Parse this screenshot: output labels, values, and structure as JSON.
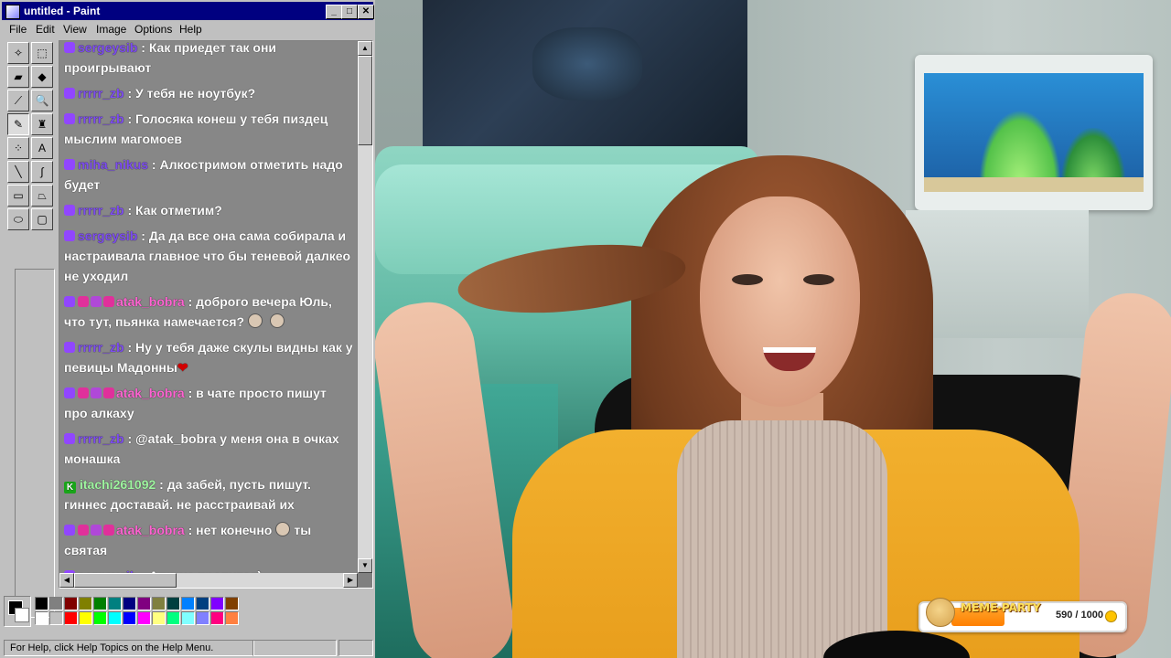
{
  "window": {
    "title": "untitled - Paint",
    "controls": {
      "minimize": "_",
      "maximize": "□",
      "close": "✕"
    }
  },
  "menu": [
    "File",
    "Edit",
    "View",
    "Image",
    "Options",
    "Help"
  ],
  "tools": [
    {
      "name": "free-form-select-icon",
      "glyph": "✧"
    },
    {
      "name": "select-icon",
      "glyph": "⬚"
    },
    {
      "name": "eraser-icon",
      "glyph": "▰"
    },
    {
      "name": "fill-bucket-icon",
      "glyph": "◆"
    },
    {
      "name": "color-picker-icon",
      "glyph": "⟋"
    },
    {
      "name": "magnifier-icon",
      "glyph": "🔍"
    },
    {
      "name": "pencil-icon",
      "glyph": "✎"
    },
    {
      "name": "brush-icon",
      "glyph": "♜"
    },
    {
      "name": "airbrush-icon",
      "glyph": "⁘"
    },
    {
      "name": "text-icon",
      "glyph": "A"
    },
    {
      "name": "line-icon",
      "glyph": "╲"
    },
    {
      "name": "curve-icon",
      "glyph": "∫"
    },
    {
      "name": "rectangle-icon",
      "glyph": "▭"
    },
    {
      "name": "polygon-icon",
      "glyph": "⏢"
    },
    {
      "name": "ellipse-icon",
      "glyph": "⬭"
    },
    {
      "name": "rounded-rectangle-icon",
      "glyph": "▢"
    }
  ],
  "chat": [
    {
      "badges": [
        "sub"
      ],
      "user": "sergeysib",
      "color": "#7d4cf0",
      "text": ": Как приедет так они проигрывают"
    },
    {
      "badges": [
        "sub"
      ],
      "user": "rrrrr_zb",
      "color": "#7d4cf0",
      "text": ": У тебя не ноутбук?"
    },
    {
      "badges": [
        "sub"
      ],
      "user": "rrrrr_zb",
      "color": "#7d4cf0",
      "text": ": Голосяка конеш у тебя пиздец мыслим магомоев"
    },
    {
      "badges": [
        "sub"
      ],
      "user": "miha_nikus",
      "color": "#7d4cf0",
      "text": ": Алкостримом отметить надо будет"
    },
    {
      "badges": [
        "sub"
      ],
      "user": "rrrrr_zb",
      "color": "#7d4cf0",
      "text": ": Как отметим?"
    },
    {
      "badges": [
        "sub"
      ],
      "user": "sergeysib",
      "color": "#7d4cf0",
      "text": ": Да да все она сама собирала и настраивала главное что бы теневой далкео не уходил"
    },
    {
      "badges": [
        "sub",
        "heart",
        "gift",
        "heart"
      ],
      "user": "atak_bobra",
      "color": "#ff64d2",
      "text": ": доброго вечера Юль, что тут, пьянка намечается?",
      "emotes": 2
    },
    {
      "badges": [
        "sub"
      ],
      "user": "rrrrr_zb",
      "color": "#7d4cf0",
      "text": ": Ну у тебя даже скулы видны как у певицы Мадонны",
      "heart": "❤"
    },
    {
      "badges": [
        "sub",
        "heart",
        "gift",
        "heart"
      ],
      "user": "atak_bobra",
      "color": "#ff64d2",
      "text": ": в чате просто пишут про алкаху"
    },
    {
      "badges": [
        "sub"
      ],
      "user": "rrrrr_zb",
      "color": "#7d4cf0",
      "text": ": @atak_bobra у меня она в очках монашка"
    },
    {
      "badges": [
        "k"
      ],
      "user": "itachi261092",
      "color": "#9ff5a0",
      "text": ": да забей, пусть пишут. гиннес доставай. не расстраивай их"
    },
    {
      "badges": [
        "sub",
        "heart",
        "gift",
        "heart"
      ],
      "user": "atak_bobra",
      "color": "#ff64d2",
      "text": ": нет конечно",
      "emotes": 1,
      "text_after": "ты святая"
    },
    {
      "badges": [
        "sub"
      ],
      "user": "sergeysib",
      "color": "#7d4cf0",
      "text": ": Алкаха пропитая)"
    }
  ],
  "palette_colors": [
    "#000000",
    "#808080",
    "#800000",
    "#808000",
    "#008000",
    "#008080",
    "#000080",
    "#800080",
    "#808040",
    "#004040",
    "#0080ff",
    "#004080",
    "#8000ff",
    "#804000",
    "#ffffff",
    "#c0c0c0",
    "#ff0000",
    "#ffff00",
    "#00ff00",
    "#00ffff",
    "#0000ff",
    "#ff00ff",
    "#ffff80",
    "#00ff80",
    "#80ffff",
    "#8080ff",
    "#ff0080",
    "#ff8040"
  ],
  "status": {
    "help": "For Help, click Help Topics on the Help Menu."
  },
  "widget": {
    "title": "MEME·PARTY",
    "progress": "590 / 1000",
    "value": 590,
    "max": 1000
  }
}
